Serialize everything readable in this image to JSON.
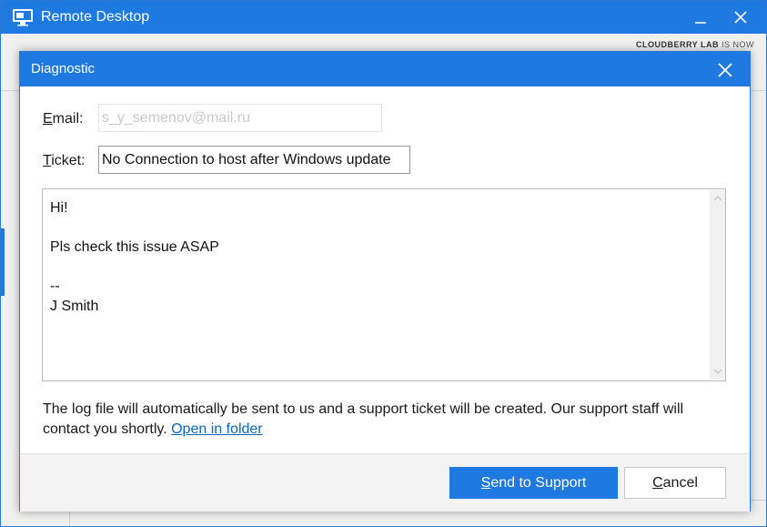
{
  "window": {
    "title": "Remote Desktop",
    "brand_strong": "CLOUDBERRY LAB",
    "brand_light": "IS NOW"
  },
  "dialog": {
    "title": "Diagnostic",
    "email": {
      "label_first": "E",
      "label_rest": "mail:",
      "value": "s_y_semenov@mail.ru"
    },
    "ticket": {
      "label_first": "T",
      "label_rest": "icket:",
      "value": "No Connection to host after Windows update"
    },
    "message": "Hi!\n\nPls check this issue ASAP\n\n--\nJ Smith",
    "info_text": "The log file will automatically be sent to us and a support ticket will be created. Our support staff will contact you shortly. ",
    "info_link": "Open in folder",
    "send_button": {
      "first": "S",
      "rest": "end to Support"
    },
    "cancel_button": {
      "first": "C",
      "rest": "ancel"
    }
  },
  "icons": {
    "app": "remote-desktop-monitor-icon",
    "minimize": "minimize-icon",
    "close": "close-icon",
    "scroll_up": "chevron-up-icon",
    "scroll_down": "chevron-down-icon"
  },
  "colors": {
    "accent": "#1e7ae0",
    "link": "#0a66c2"
  }
}
